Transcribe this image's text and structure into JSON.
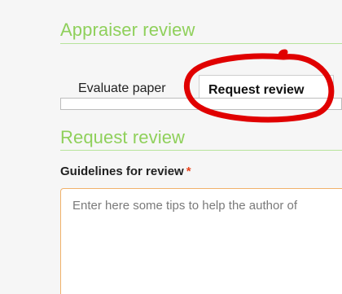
{
  "section": {
    "title": "Appraiser review"
  },
  "tabs": [
    {
      "label": "Evaluate paper",
      "active": false
    },
    {
      "label": "Request review",
      "active": true
    }
  ],
  "request_review": {
    "title": "Request review",
    "guidelines_label": "Guidelines for review",
    "required_marker": "*",
    "textarea_placeholder": "Enter here some tips to help the author of"
  },
  "colors": {
    "heading_green": "#8fd05b",
    "rule_green": "#b6e39b",
    "required_red": "#e8451e",
    "textarea_border_orange": "#f0b16a",
    "annotation_red": "#e00000"
  }
}
